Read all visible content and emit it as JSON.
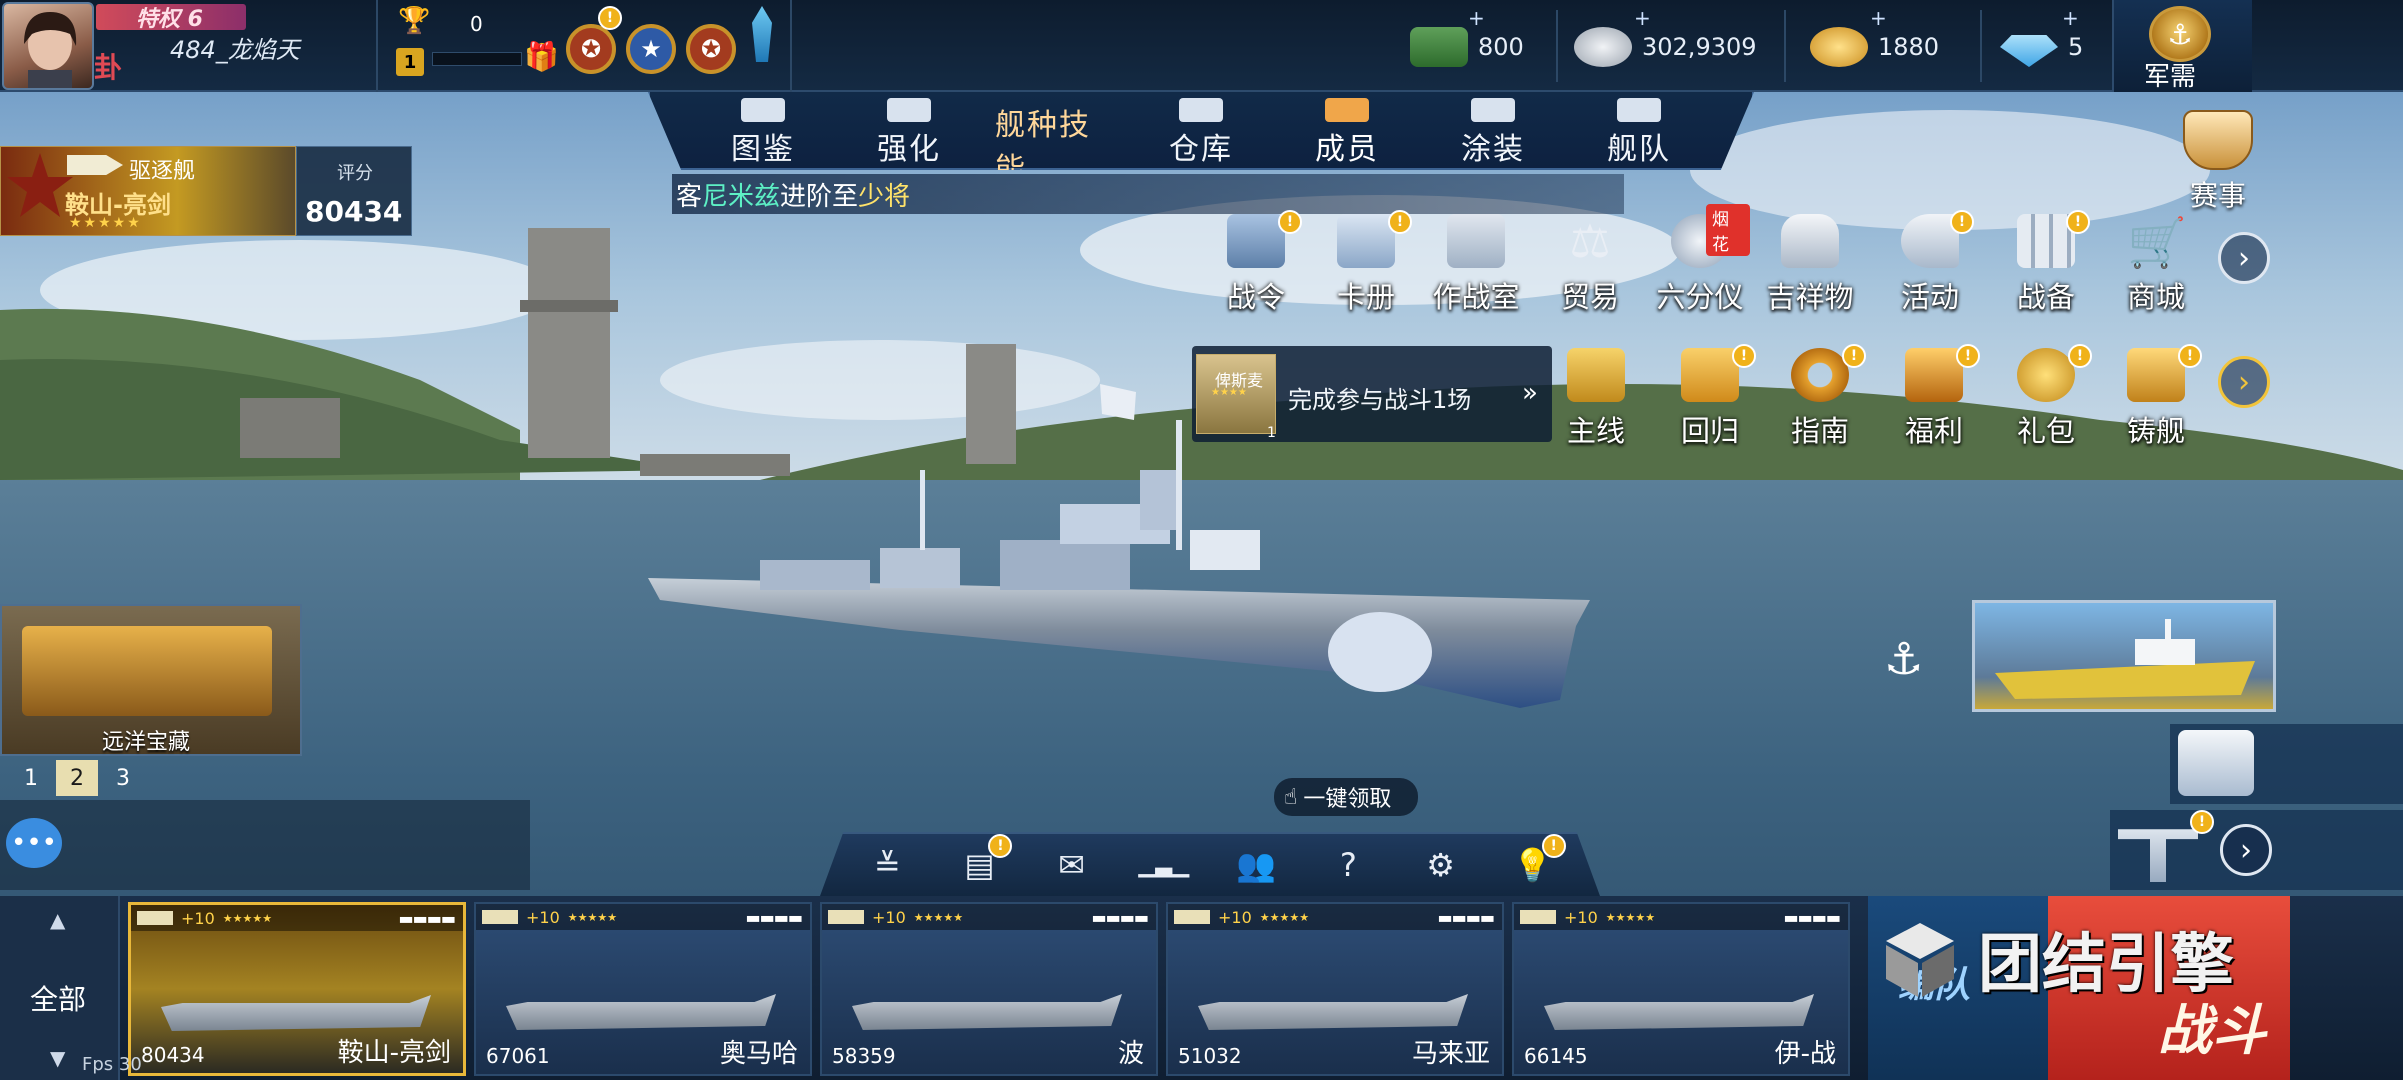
{
  "player": {
    "vip_label": "特权 6",
    "name": "484_龙焰天",
    "trophy_count": "0",
    "level": "1"
  },
  "resources": [
    {
      "icon": "cash-stack-icon",
      "value": "800"
    },
    {
      "icon": "silver-coins-icon",
      "value": "302,9309"
    },
    {
      "icon": "gold-coins-icon",
      "value": "1880"
    },
    {
      "icon": "diamond-icon",
      "value": "5"
    }
  ],
  "supply": {
    "label": "军需"
  },
  "tabs": [
    {
      "label": "图鉴",
      "icon": "book-icon",
      "active": false
    },
    {
      "label": "强化",
      "icon": "upgrade-icon",
      "active": false
    },
    {
      "label": "舰种技能",
      "icon": "skill-scroll-icon",
      "active": true
    },
    {
      "label": "仓库",
      "icon": "warehouse-icon",
      "active": false
    },
    {
      "label": "成员",
      "icon": "crew-icon",
      "active": false
    },
    {
      "label": "涂装",
      "icon": "paint-flag-icon",
      "active": false
    },
    {
      "label": "舰队",
      "icon": "fleet-flag-icon",
      "active": false
    }
  ],
  "ticker": {
    "prefix": "客",
    "name": "尼米兹",
    "middle": "进阶至",
    "rank": "少将"
  },
  "ship_card": {
    "type": "驱逐舰",
    "name": "鞍山-亮剑",
    "stars": "★★★★★",
    "score_label": "评分",
    "score_value": "80434"
  },
  "event": {
    "label": "赛事"
  },
  "features_row1": [
    {
      "label": "战令",
      "icon": "battle-pass-icon",
      "badge": "!"
    },
    {
      "label": "卡册",
      "icon": "card-album-icon",
      "badge": "!"
    },
    {
      "label": "作战室",
      "icon": "war-room-icon",
      "badge": ""
    },
    {
      "label": "贸易",
      "icon": "scales-icon",
      "badge": ""
    },
    {
      "label": "六分仪",
      "icon": "sextant-icon",
      "badge": "",
      "tag": "烟花"
    },
    {
      "label": "吉祥物",
      "icon": "mascot-cat-icon",
      "badge": ""
    },
    {
      "label": "活动",
      "icon": "megaphone-icon",
      "badge": "!"
    },
    {
      "label": "战备",
      "icon": "supplies-icon",
      "badge": "!"
    },
    {
      "label": "商城",
      "icon": "shopping-cart-icon",
      "badge": ""
    }
  ],
  "features_row2": [
    {
      "label": "主线",
      "icon": "main-quest-icon",
      "badge": ""
    },
    {
      "label": "回归",
      "icon": "return-letter-icon",
      "badge": "!"
    },
    {
      "label": "指南",
      "icon": "guide-lifebuoy-icon",
      "badge": "!"
    },
    {
      "label": "福利",
      "icon": "treasure-chest-icon",
      "badge": "!"
    },
    {
      "label": "礼包",
      "icon": "gift-coins-icon",
      "badge": "!"
    },
    {
      "label": "铸舰",
      "icon": "forge-icon",
      "badge": "!"
    }
  ],
  "task": {
    "ship_name": "俾斯麦",
    "ship_stars": "★★★★",
    "ship_count": "1",
    "text": "完成参与战斗1场",
    "chevron": "»"
  },
  "treasure": {
    "label": "远洋宝藏"
  },
  "pager": [
    "1",
    "2",
    "3"
  ],
  "one_click": {
    "label": "一键领取"
  },
  "util_icons": [
    {
      "icon": "collapse-chevrons-icon",
      "glyph": "≚",
      "badge": ""
    },
    {
      "icon": "clipboard-icon",
      "glyph": "▤",
      "badge": "!"
    },
    {
      "icon": "mail-icon",
      "glyph": "✉",
      "badge": ""
    },
    {
      "icon": "ranking-chart-icon",
      "glyph": "▁▃▁",
      "badge": ""
    },
    {
      "icon": "friends-icon",
      "glyph": "👥",
      "badge": ""
    },
    {
      "icon": "help-icon",
      "glyph": "?",
      "badge": ""
    },
    {
      "icon": "settings-gear-icon",
      "glyph": "⚙",
      "badge": ""
    },
    {
      "icon": "hint-bulb-icon",
      "glyph": "💡",
      "badge": "!"
    }
  ],
  "all_button": {
    "label": "全部"
  },
  "ships": [
    {
      "name": "鞍山-亮剑",
      "score": "80434",
      "plus": "+10",
      "stars": "★★★★★",
      "active": true
    },
    {
      "name": "奥马哈",
      "score": "67061",
      "plus": "+10",
      "stars": "★★★★★",
      "active": false
    },
    {
      "name": "波",
      "score": "58359",
      "plus": "+10",
      "stars": "★★★★★",
      "active": false
    },
    {
      "name": "马来亚",
      "score": "51032",
      "plus": "+10",
      "stars": "★★★★★",
      "active": false
    },
    {
      "name": "伊-战",
      "score": "66145",
      "plus": "+10",
      "stars": "★★★★★",
      "active": false
    }
  ],
  "battle": {
    "fleet_label": "编队",
    "battle_label": "战斗"
  },
  "fps_label": "Fps 30",
  "watermark": {
    "text": "团结引擎"
  },
  "colors": {
    "accent_gold": "#f2c43a",
    "badge": "#f0b21a",
    "battle_red": "#d8362a",
    "sea": "#3c627f"
  }
}
